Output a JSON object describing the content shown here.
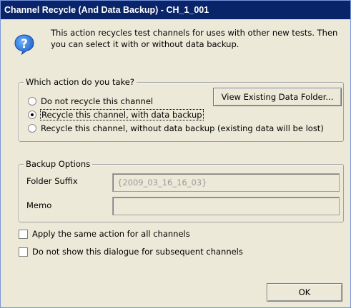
{
  "window": {
    "title": "Channel Recycle (And Data Backup) - CH_1_001"
  },
  "message": {
    "icon": "question-icon",
    "text": "This action recycles test channels for uses with other new tests. Then you can select it with or without data backup."
  },
  "action_group": {
    "legend": "Which action do you take?",
    "options": [
      {
        "label": "Do not recycle this channel",
        "checked": false
      },
      {
        "label": "Recycle this channel, with data backup",
        "checked": true
      },
      {
        "label": "Recycle this channel, without data backup (existing data will be lost)",
        "checked": false
      }
    ],
    "view_folder_button": "View Existing Data Folder..."
  },
  "backup_group": {
    "legend": "Backup Options",
    "folder_suffix_label": "Folder Suffix",
    "folder_suffix_value": "{2009_03_16_16_03}",
    "memo_label": "Memo",
    "memo_value": ""
  },
  "checkboxes": [
    {
      "label": "Apply the same action for all channels",
      "checked": false
    },
    {
      "label": "Do not show this dialogue for subsequent channels",
      "checked": false
    }
  ],
  "ok_button": "OK",
  "colors": {
    "titlebar": "#0a246a",
    "dialog_bg": "#ece9d8",
    "icon_blue": "#1e63c8"
  }
}
